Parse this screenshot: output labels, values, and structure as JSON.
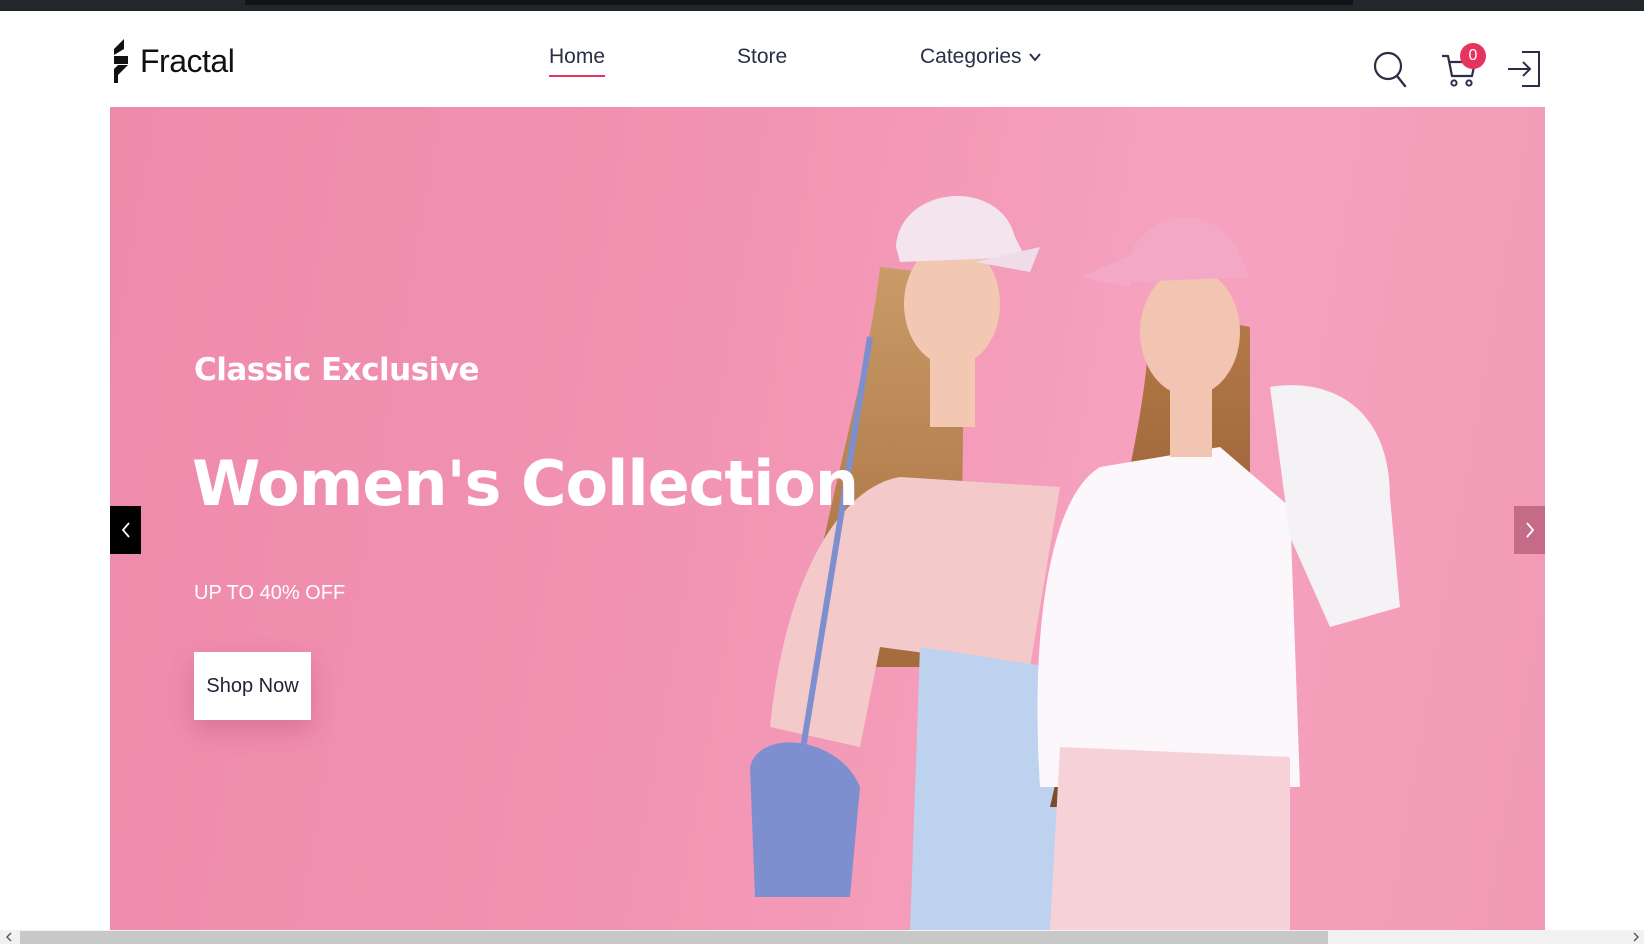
{
  "brand": {
    "name": "Fractal",
    "accent_color": "#e4345f"
  },
  "nav": {
    "home": "Home",
    "store": "Store",
    "categories": "Categories"
  },
  "header_icons": {
    "search": "search-icon",
    "cart": "cart-icon",
    "login": "login-icon"
  },
  "cart": {
    "count": "0"
  },
  "hero": {
    "eyebrow": "Classic Exclusive",
    "title": "Women's Collection",
    "offer": "UP TO 40% OFF",
    "cta": "Shop Now",
    "background_color": "#f193b2"
  },
  "carousel": {
    "prev_icon": "chevron-left-icon",
    "next_icon": "chevron-right-icon"
  }
}
